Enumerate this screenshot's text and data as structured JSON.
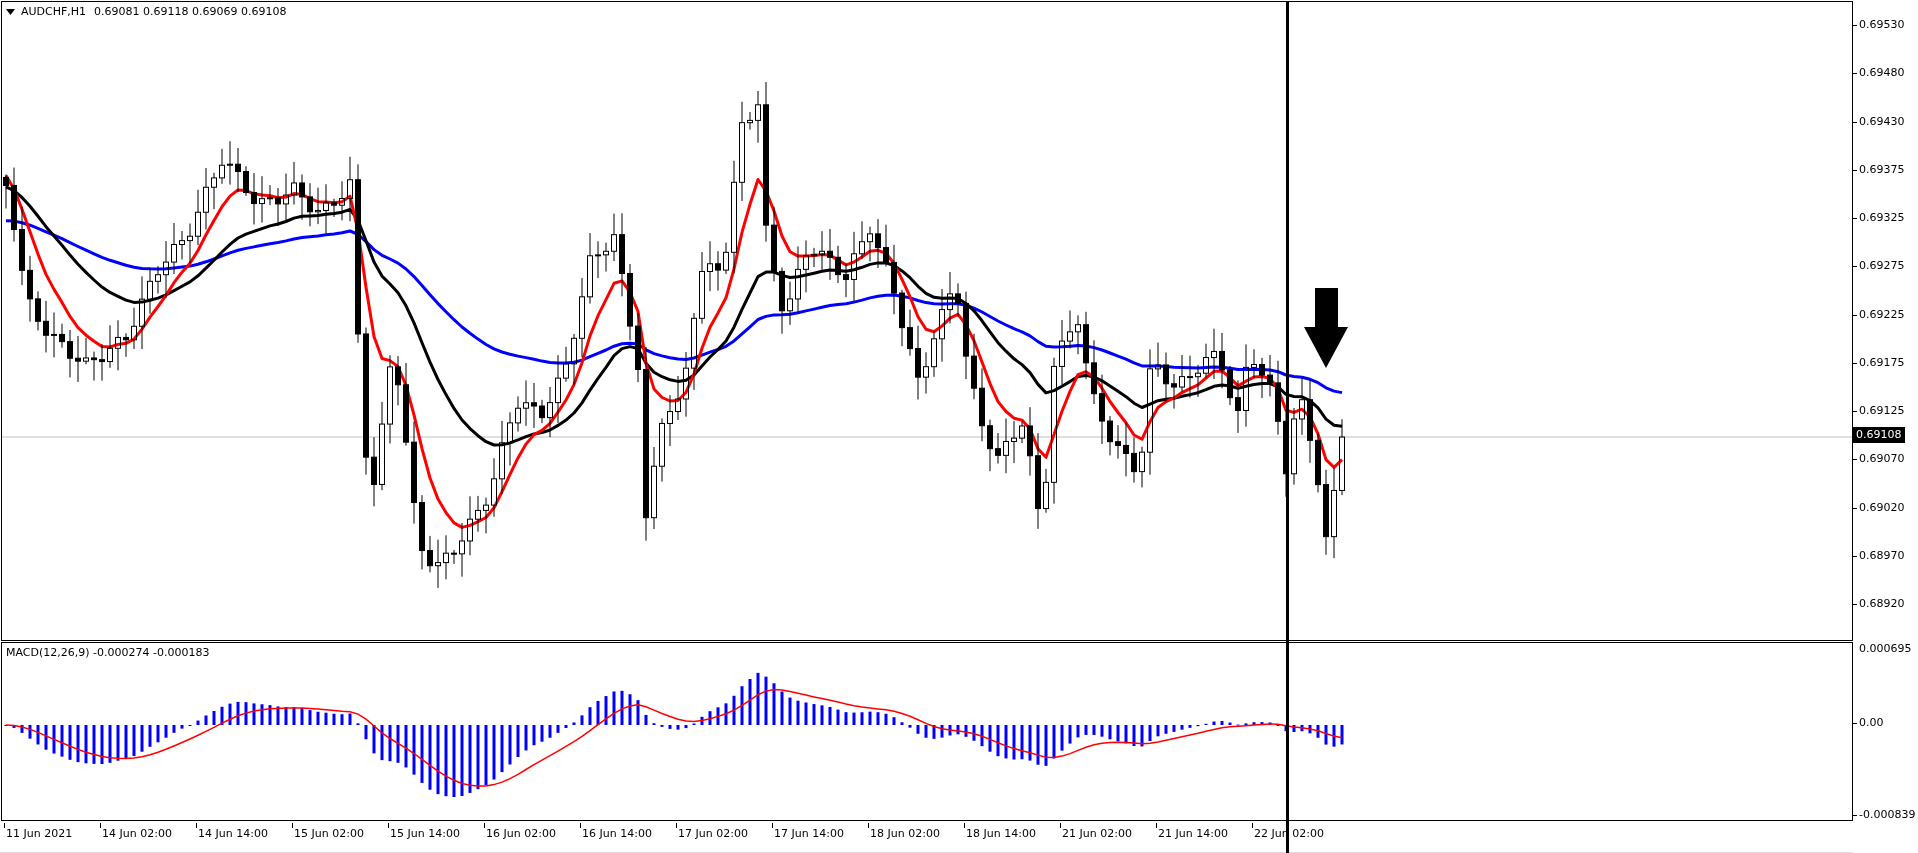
{
  "chart": {
    "symbol": "AUDCHF,H1",
    "quote": "0.69081 0.69118 0.69069 0.69108"
  },
  "price_axis": {
    "labels": [
      "0.69530",
      "0.69480",
      "0.69430",
      "0.69375",
      "0.69325",
      "0.69275",
      "0.69225",
      "0.69175",
      "0.69125",
      "0.69070",
      "0.69020",
      "0.68970",
      "0.68920"
    ],
    "current_price": "0.69108"
  },
  "macd": {
    "title": "MACD(12,26,9) -0.000274 -0.000183",
    "axis_labels": [
      "0.000695",
      "0.00",
      "-0.000839"
    ]
  },
  "time_axis": {
    "labels": [
      "11 Jun 2021",
      "14 Jun 02:00",
      "14 Jun 14:00",
      "15 Jun 02:00",
      "15 Jun 14:00",
      "16 Jun 02:00",
      "16 Jun 14:00",
      "17 Jun 02:00",
      "17 Jun 14:00",
      "18 Jun 02:00",
      "18 Jun 14:00",
      "21 Jun 02:00",
      "21 Jun 14:00",
      "22 Jun 02:00"
    ]
  }
}
